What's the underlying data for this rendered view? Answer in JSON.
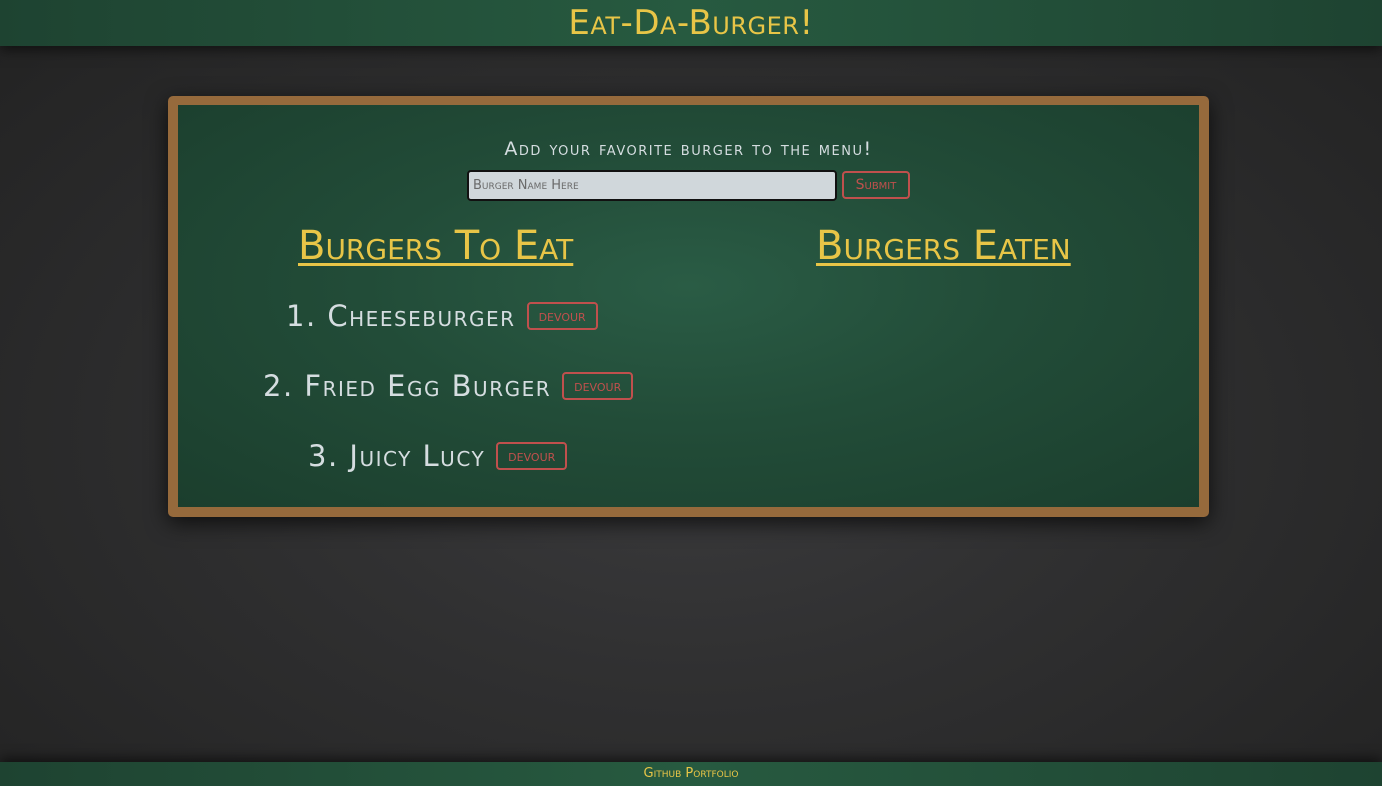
{
  "header": {
    "title": "Eat-Da-Burger!"
  },
  "form": {
    "prompt": "Add your favorite burger to the menu!",
    "input_placeholder": "Burger Name Here",
    "input_value": "",
    "submit_label": "Submit"
  },
  "to_eat": {
    "title": "Burgers To Eat",
    "items": [
      {
        "number": "1.",
        "name": "Cheeseburger",
        "button_label": "devour"
      },
      {
        "number": "2.",
        "name": "Fried Egg Burger",
        "button_label": "devour"
      },
      {
        "number": "3.",
        "name": "Juicy Lucy",
        "button_label": "devour"
      }
    ]
  },
  "eaten": {
    "title": "Burgers Eaten",
    "items": []
  },
  "footer": {
    "link_label": "Github Portfolio"
  },
  "colors": {
    "accent_yellow": "#e8c547",
    "button_red": "#c0504d",
    "chalkboard_green": "#224c38",
    "frame_wood": "#966a3c"
  }
}
